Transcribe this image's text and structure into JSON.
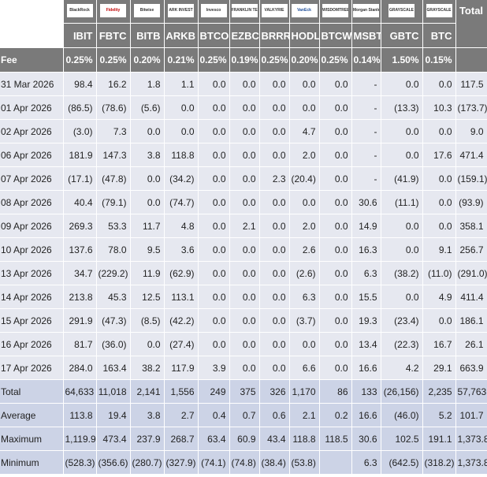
{
  "logos": [
    "BlackRock",
    "Fidelity",
    "Bitwise",
    "ARK INVEST",
    "Invesco",
    "FRANKLIN TEMPLETON",
    "VALKYRIE",
    "VanEck",
    "WISDOMTREE",
    "Morgan Stanley",
    "GRAYSCALE",
    "GRAYSCALE"
  ],
  "total_header": "Total",
  "tickers": [
    "IBIT",
    "FBTC",
    "BITB",
    "ARKB",
    "BTCO",
    "EZBC",
    "BRRR",
    "HODL",
    "BTCW",
    "MSBT",
    "GBTC",
    "BTC"
  ],
  "fee": {
    "label": "Fee",
    "values": [
      "0.25%",
      "0.25%",
      "0.20%",
      "0.21%",
      "0.25%",
      "0.19%",
      "0.25%",
      "0.20%",
      "0.25%",
      "0.14%",
      "1.50%",
      "0.15%"
    ]
  },
  "rows": [
    {
      "date": "31 Mar 2026",
      "cells": [
        "98.4",
        "16.2",
        "1.8",
        "1.1",
        "0.0",
        "0.0",
        "0.0",
        "0.0",
        "0.0",
        "-",
        "0.0",
        "0.0"
      ],
      "total": "117.5"
    },
    {
      "date": "01 Apr 2026",
      "cells": [
        "(86.5)",
        "(78.6)",
        "(5.6)",
        "0.0",
        "0.0",
        "0.0",
        "0.0",
        "0.0",
        "0.0",
        "-",
        "(13.3)",
        "10.3"
      ],
      "total": "(173.7)"
    },
    {
      "date": "02 Apr 2026",
      "cells": [
        "(3.0)",
        "7.3",
        "0.0",
        "0.0",
        "0.0",
        "0.0",
        "0.0",
        "4.7",
        "0.0",
        "-",
        "0.0",
        "0.0"
      ],
      "total": "9.0"
    },
    {
      "date": "06 Apr 2026",
      "cells": [
        "181.9",
        "147.3",
        "3.8",
        "118.8",
        "0.0",
        "0.0",
        "0.0",
        "2.0",
        "0.0",
        "-",
        "0.0",
        "17.6"
      ],
      "total": "471.4"
    },
    {
      "date": "07 Apr 2026",
      "cells": [
        "(17.1)",
        "(47.8)",
        "0.0",
        "(34.2)",
        "0.0",
        "0.0",
        "2.3",
        "(20.4)",
        "0.0",
        "-",
        "(41.9)",
        "0.0"
      ],
      "total": "(159.1)"
    },
    {
      "date": "08 Apr 2026",
      "cells": [
        "40.4",
        "(79.1)",
        "0.0",
        "(74.7)",
        "0.0",
        "0.0",
        "0.0",
        "0.0",
        "0.0",
        "30.6",
        "(11.1)",
        "0.0"
      ],
      "total": "(93.9)"
    },
    {
      "date": "09 Apr 2026",
      "cells": [
        "269.3",
        "53.3",
        "11.7",
        "4.8",
        "0.0",
        "2.1",
        "0.0",
        "2.0",
        "0.0",
        "14.9",
        "0.0",
        "0.0"
      ],
      "total": "358.1"
    },
    {
      "date": "10 Apr 2026",
      "cells": [
        "137.6",
        "78.0",
        "9.5",
        "3.6",
        "0.0",
        "0.0",
        "0.0",
        "2.6",
        "0.0",
        "16.3",
        "0.0",
        "9.1"
      ],
      "total": "256.7"
    },
    {
      "date": "13 Apr 2026",
      "cells": [
        "34.7",
        "(229.2)",
        "11.9",
        "(62.9)",
        "0.0",
        "0.0",
        "0.0",
        "(2.6)",
        "0.0",
        "6.3",
        "(38.2)",
        "(11.0)"
      ],
      "total": "(291.0)"
    },
    {
      "date": "14 Apr 2026",
      "cells": [
        "213.8",
        "45.3",
        "12.5",
        "113.1",
        "0.0",
        "0.0",
        "0.0",
        "6.3",
        "0.0",
        "15.5",
        "0.0",
        "4.9"
      ],
      "total": "411.4"
    },
    {
      "date": "15 Apr 2026",
      "cells": [
        "291.9",
        "(47.3)",
        "(8.5)",
        "(42.2)",
        "0.0",
        "0.0",
        "0.0",
        "(3.7)",
        "0.0",
        "19.3",
        "(23.4)",
        "0.0"
      ],
      "total": "186.1"
    },
    {
      "date": "16 Apr 2026",
      "cells": [
        "81.7",
        "(36.0)",
        "0.0",
        "(27.4)",
        "0.0",
        "0.0",
        "0.0",
        "0.0",
        "0.0",
        "13.4",
        "(22.3)",
        "16.7"
      ],
      "total": "26.1"
    },
    {
      "date": "17 Apr 2026",
      "cells": [
        "284.0",
        "163.4",
        "38.2",
        "117.9",
        "3.9",
        "0.0",
        "0.0",
        "6.6",
        "0.0",
        "16.6",
        "4.2",
        "29.1"
      ],
      "total": "663.9"
    }
  ],
  "summary": [
    {
      "label": "Total",
      "cells": [
        "64,633",
        "11,018",
        "2,141",
        "1,556",
        "249",
        "375",
        "326",
        "1,170",
        "86",
        "133",
        "(26,156)",
        "2,235"
      ],
      "total": "57,763"
    },
    {
      "label": "Average",
      "cells": [
        "113.8",
        "19.4",
        "3.8",
        "2.7",
        "0.4",
        "0.7",
        "0.6",
        "2.1",
        "0.2",
        "16.6",
        "(46.0)",
        "5.2"
      ],
      "total": "101.7"
    },
    {
      "label": "Maximum",
      "cells": [
        "1,119.9",
        "473.4",
        "237.9",
        "268.7",
        "63.4",
        "60.9",
        "43.4",
        "118.8",
        "118.5",
        "30.6",
        "102.5",
        "191.1"
      ],
      "total": "1,373.8"
    },
    {
      "label": "Minimum",
      "cells": [
        "(528.3)",
        "(356.6)",
        "(280.7)",
        "(327.9)",
        "(74.1)",
        "(74.8)",
        "(38.4)",
        "(53.8)",
        "6.3",
        "(642.5)",
        "(318.2)"
      ],
      "total": "1,373.8"
    }
  ]
}
